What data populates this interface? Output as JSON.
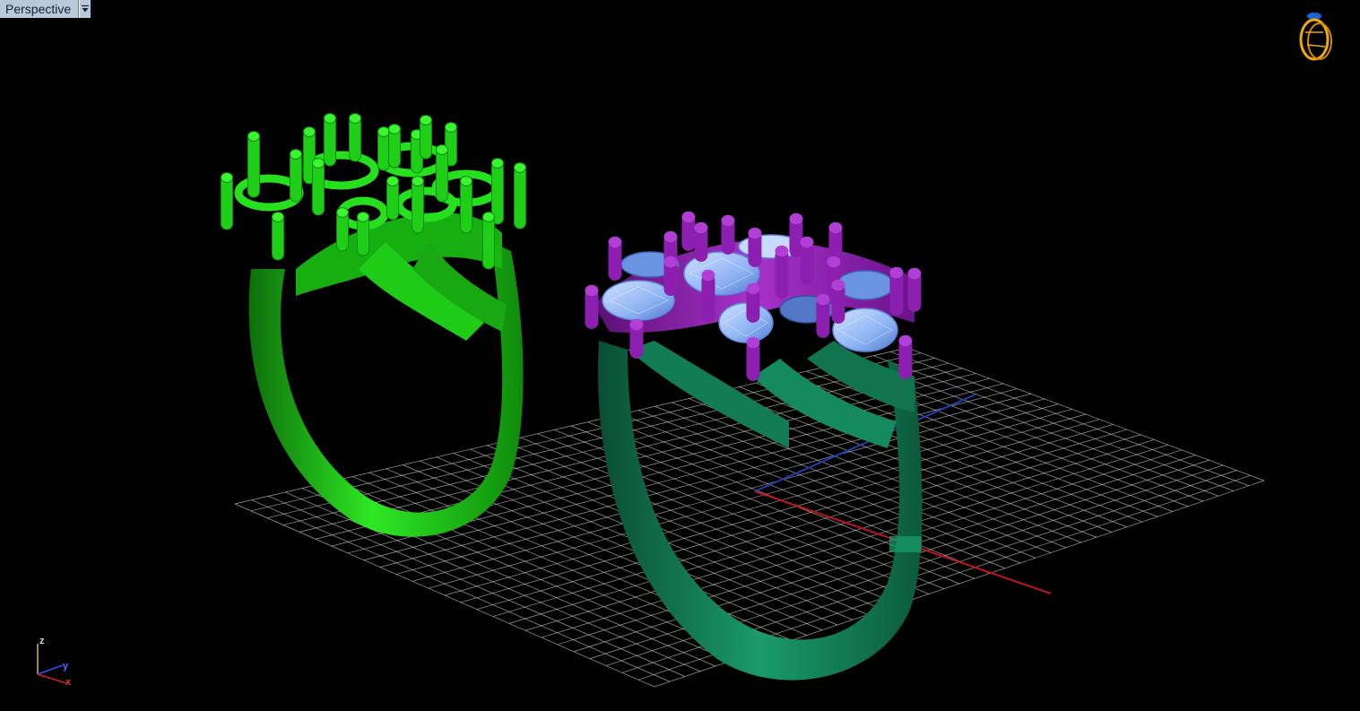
{
  "viewport": {
    "name": "Perspective",
    "background": "#000000"
  },
  "grid": {
    "line_color": "#d0d0d0",
    "x_axis_color": "#c0131b",
    "y_axis_color": "#1e3fb0"
  },
  "models": {
    "left_ring": {
      "color": "#22d61a",
      "shade": "#0f8a0c"
    },
    "right_ring": {
      "color": "#13835a",
      "shade": "#0a4d34"
    },
    "prongs": {
      "color": "#8a1ea8",
      "shade": "#5a0f72"
    },
    "gems": {
      "color": "#9ec3ff",
      "shade": "#5d88d8"
    }
  },
  "axis_widget": {
    "z": "z",
    "y": "y",
    "x": "x"
  },
  "icons": {
    "corner_icon": "ring-logo-icon",
    "dropdown": "chevron-down-icon"
  }
}
